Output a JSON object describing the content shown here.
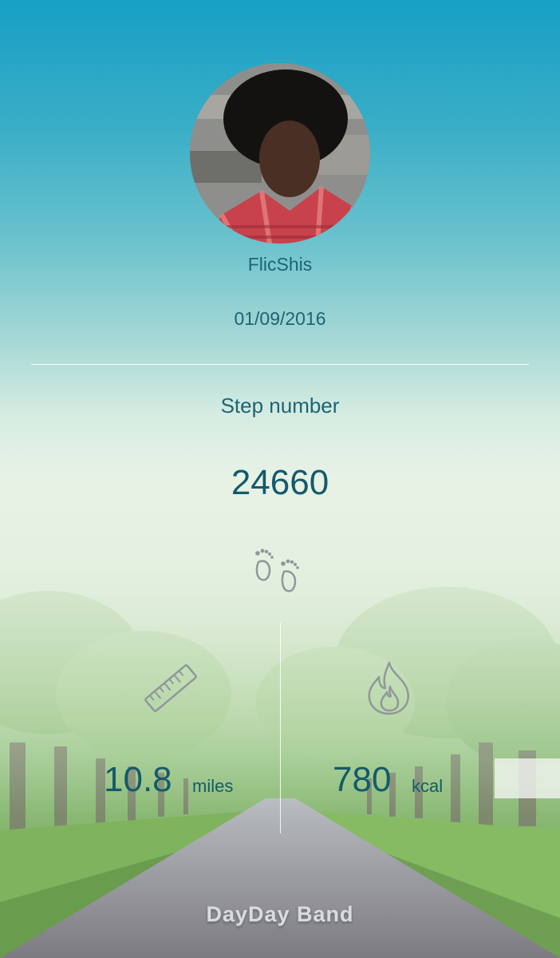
{
  "profile": {
    "avatar": "user-photo",
    "username": "FlicShis",
    "date": "01/09/2016"
  },
  "steps": {
    "label": "Step number",
    "value": "24660",
    "icon": "footprints-icon"
  },
  "distance": {
    "value": "10.8",
    "unit": "miles",
    "icon": "ruler-icon"
  },
  "calories": {
    "value": "780",
    "unit": "kcal",
    "icon": "flame-icon"
  },
  "brand": "DayDay Band",
  "colors": {
    "sky_top": "#179fc4",
    "text_teal": "#1f6373",
    "value_teal": "#145a6a",
    "icon_gray": "#8f9899",
    "grass": "#86b56f",
    "road": "#8b8a90"
  }
}
